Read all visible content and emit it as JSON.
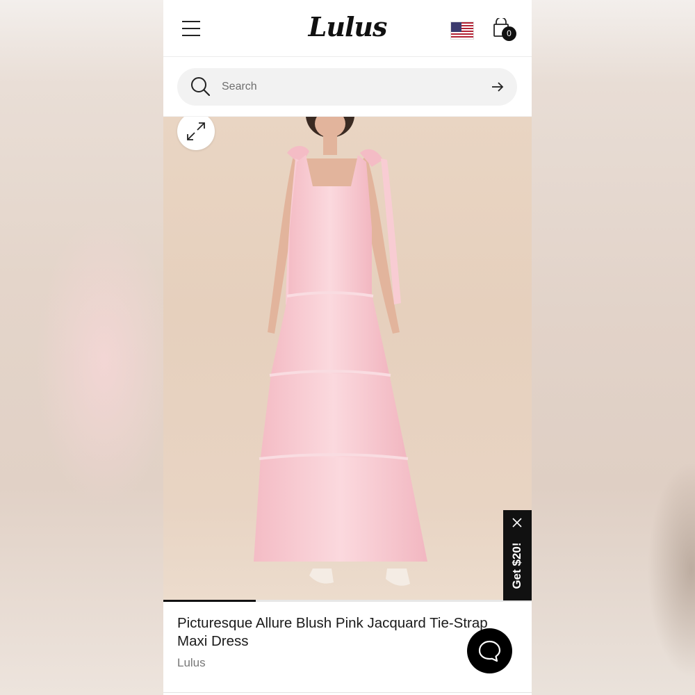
{
  "header": {
    "logo_text": "Lulus",
    "menu_icon": "hamburger-menu-icon",
    "region_icon": "us-flag-icon",
    "cart_icon": "shopping-bag-icon",
    "cart_count": "0"
  },
  "search": {
    "placeholder": "Search",
    "icon": "search-icon",
    "submit_icon": "arrow-right-icon"
  },
  "product": {
    "expand_icon": "expand-icon",
    "image_progress": 0.25,
    "title": "Picturesque Allure Blush Pink Jacquard Tie-Strap Maxi Dress",
    "brand": "Lulus"
  },
  "promo": {
    "label": "Get $20!",
    "close_icon": "close-icon"
  },
  "chat": {
    "icon": "chat-bubble-icon"
  },
  "colors": {
    "accent": "#111111",
    "dress_pink": "#f7c9cf",
    "backdrop": "#e7d2c0"
  }
}
